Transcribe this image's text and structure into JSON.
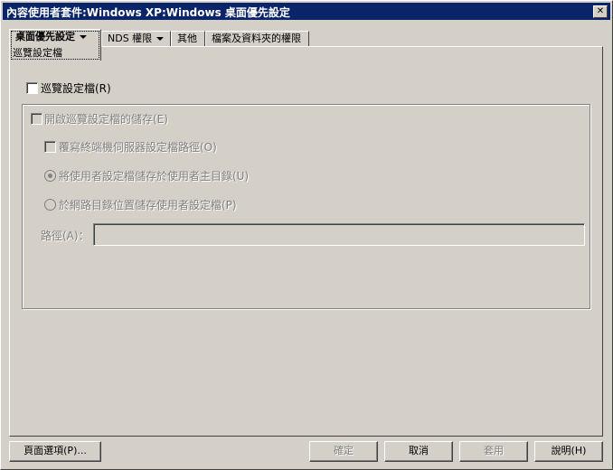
{
  "window": {
    "title": "內容使用者套件:Windows XP:Windows 桌面優先設定",
    "close_glyph": "✕"
  },
  "tabs": [
    {
      "label": "桌面優先設定",
      "sub": "巡覽設定檔",
      "has_dropdown": true,
      "active": true
    },
    {
      "label": "NDS 權限",
      "has_dropdown": true
    },
    {
      "label": "其他"
    },
    {
      "label": "檔案及資料夾的權限"
    }
  ],
  "options": {
    "roaming_profile": {
      "label": "巡覽設定檔(R)",
      "checked": false
    },
    "enable_profile_storage": {
      "label": "開啟巡覽設定檔的儲存(E)",
      "checked": false,
      "disabled": true
    },
    "override_terminal_server": {
      "label": "覆寫終端機伺服器設定檔路徑(O)",
      "checked": false,
      "disabled": true
    },
    "store_in_home_dir": {
      "label": "將使用者設定檔儲存於使用者主目錄(U)",
      "selected": true,
      "disabled": true
    },
    "store_in_network_dir": {
      "label": "於網路目錄位置儲存使用者設定檔(P)",
      "selected": false,
      "disabled": true
    },
    "path": {
      "label": "路徑(A)：",
      "value": ""
    }
  },
  "buttons": {
    "page_options": "頁面選項(P)...",
    "ok": "確定",
    "cancel": "取消",
    "apply": "套用",
    "help": "說明(H)"
  }
}
